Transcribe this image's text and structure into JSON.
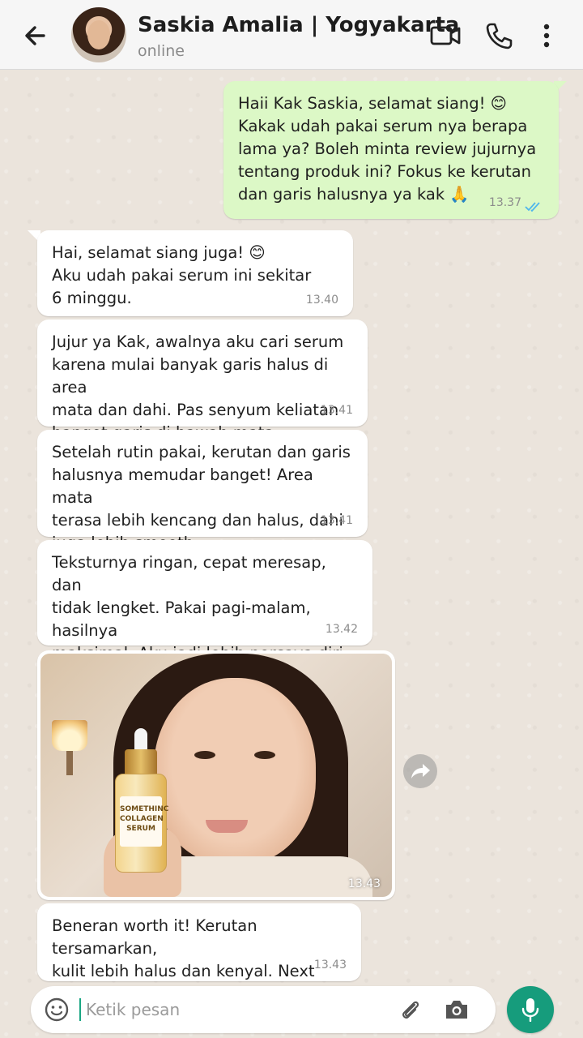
{
  "header": {
    "name": "Saskia Amalia | Yogyakarta",
    "status": "online"
  },
  "messages": [
    {
      "direction": "out",
      "text": "Haii Kak Saskia, selamat siang! 😊\nKakak udah pakai serum nya berapa\nlama ya? Boleh minta review jujurnya\ntentang produk ini? Fokus ke kerutan\ndan garis halusnya ya kak 🙏",
      "time": "13.37",
      "read": true
    },
    {
      "direction": "in",
      "text": "Hai, selamat siang juga! 😊\nAku udah pakai serum ini sekitar\n6 minggu.",
      "time": "13.40"
    },
    {
      "direction": "in",
      "text": "Jujur ya Kak, awalnya aku cari serum\nkarena mulai banyak garis halus di area\nmata dan dahi. Pas senyum keliatan\nbanget garis di bawah mata.",
      "time": "13.41"
    },
    {
      "direction": "in",
      "text": "Setelah rutin pakai, kerutan dan garis\nhalusnya memudar banget! Area mata\nterasa lebih kencang dan halus, dahi\njuga lebih smooth.",
      "time": "13.41"
    },
    {
      "direction": "in",
      "text": "Teksturnya ringan, cepat meresap, dan\ntidak lengket. Pakai pagi-malam, hasilnya\nmaksimal. Aku jadi lebih percaya diri\nbanget sekarang! 🥰",
      "time": "13.42"
    },
    {
      "direction": "in",
      "type": "photo",
      "product_label": "SOMETHINC\nCOLLAGEN\nSERUM",
      "time": "13.43"
    },
    {
      "direction": "in",
      "text": "Beneran worth it! Kerutan tersamarkan,\nkulit lebih halus dan kenyal. Next time aku\nmau stok lagi nih Kak! 😍",
      "time": "13.43"
    }
  ],
  "composer": {
    "placeholder": "Ketik pesan"
  },
  "colors": {
    "outgoing_bubble": "#dcf8c6",
    "incoming_bubble": "#ffffff",
    "accent": "#169c7c",
    "read_ticks": "#4fb6ec"
  },
  "icons": [
    "back-arrow-icon",
    "video-call-icon",
    "phone-icon",
    "more-options-icon",
    "forward-icon",
    "emoji-icon",
    "attach-icon",
    "camera-icon",
    "mic-icon"
  ]
}
